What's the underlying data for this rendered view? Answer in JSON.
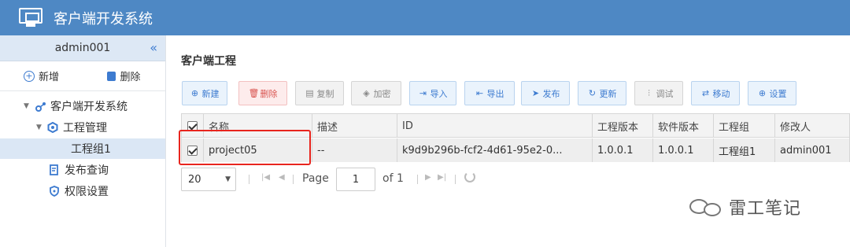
{
  "app": {
    "title": "客户端开发系统",
    "logo_icon": "monitor-icon"
  },
  "sidebar": {
    "user": "admin001",
    "collapse_glyph": "«",
    "actions": [
      {
        "label": "新增",
        "icon": "add-circle-icon"
      },
      {
        "label": "删除",
        "icon": "trash-icon"
      }
    ],
    "tree": [
      {
        "label": "客户端开发系统",
        "icon": "system-nodes-icon",
        "level": 0,
        "expanded": true
      },
      {
        "label": "工程管理",
        "icon": "gear-hex-icon",
        "level": 1,
        "expanded": true
      },
      {
        "label": "工程组1",
        "icon": "",
        "level": 2,
        "selected": true
      },
      {
        "label": "发布查询",
        "icon": "query-doc-icon",
        "level": 1
      },
      {
        "label": "权限设置",
        "icon": "shield-icon",
        "level": 1
      }
    ]
  },
  "main": {
    "heading": "客户端工程",
    "toolbar": [
      {
        "label": "新建",
        "glyph": "⊕",
        "style": "blue"
      },
      {
        "label": "删除",
        "glyph": "🗑",
        "style": "red"
      },
      {
        "label": "复制",
        "glyph": "▤",
        "style": "gray"
      },
      {
        "label": "加密",
        "glyph": "◈",
        "style": "gray"
      },
      {
        "label": "导入",
        "glyph": "⇥",
        "style": "blue"
      },
      {
        "label": "导出",
        "glyph": "⇤",
        "style": "blue"
      },
      {
        "label": "发布",
        "glyph": "➤",
        "style": "blue"
      },
      {
        "label": "更新",
        "glyph": "↻",
        "style": "blue"
      },
      {
        "label": "调试",
        "glyph": "⫶",
        "style": "gray"
      },
      {
        "label": "移动",
        "glyph": "⇄",
        "style": "blue"
      },
      {
        "label": "设置",
        "glyph": "⊕",
        "style": "blue"
      }
    ],
    "table": {
      "headers": [
        "名称",
        "描述",
        "ID",
        "工程版本",
        "软件版本",
        "工程组",
        "修改人"
      ],
      "rows": [
        {
          "checked": true,
          "cells": [
            "project05",
            "--",
            "k9d9b296b-fcf2-4d61-95e2-0...",
            "1.0.0.1",
            "1.0.0.1",
            "工程组1",
            "admin001"
          ]
        }
      ],
      "header_checked": true
    },
    "pager": {
      "page_size": "20",
      "page_label": "Page",
      "page_value": "1",
      "of_label": "of 1"
    }
  },
  "watermark": "雷工笔记",
  "colors": {
    "header": "#4e88c4",
    "accent": "#3d7bd0",
    "highlight": "#e8251e"
  }
}
